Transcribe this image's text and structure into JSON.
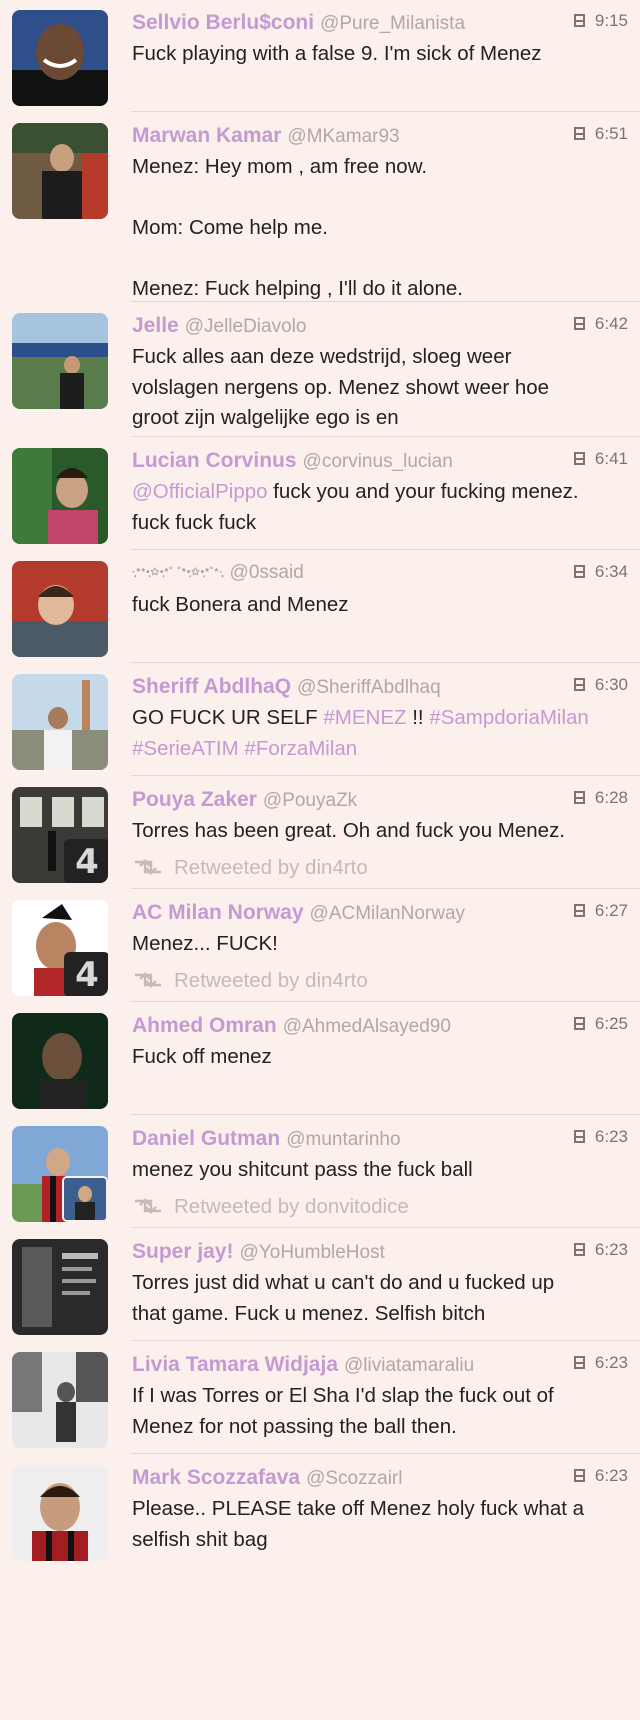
{
  "colors": {
    "background": "#fcf0ec",
    "name": "#c49ad3",
    "handle": "#b1a7a5",
    "text": "#222222",
    "retweet": "#c6b9b6"
  },
  "tweets": [
    {
      "name": "Sellvio Berlu$coni",
      "handle": "@Pure_Milanista",
      "time": "9:15",
      "lines": [
        [
          {
            "t": "Fuck playing with a false 9. I'm sick of Menez"
          }
        ]
      ]
    },
    {
      "name": "Marwan Kamar",
      "handle": "@MKamar93",
      "time": "6:51",
      "lines": [
        [
          {
            "t": "Menez: Hey mom , am free now."
          }
        ],
        [],
        [
          {
            "t": "Mom: Come help me."
          }
        ],
        [],
        [
          {
            "t": "Menez: Fuck helping , I'll do it alone."
          }
        ]
      ]
    },
    {
      "name": "Jelle",
      "handle": "@JelleDiavolo",
      "time": "6:42",
      "lines": [
        [
          {
            "t": "Fuck alles aan deze wedstrijd, sloeg weer"
          }
        ],
        [
          {
            "t": "volslagen nergens op. Menez showt weer hoe"
          }
        ],
        [
          {
            "t": "groot zijn walgelijke ego is en"
          }
        ]
      ]
    },
    {
      "name": "Lucian Corvinus",
      "handle": "@corvinus_lucian",
      "time": "6:41",
      "lines": [
        [
          {
            "t": "@OfficialPippo",
            "k": "mention"
          },
          {
            "t": " fuck you and your fucking menez."
          }
        ],
        [
          {
            "t": "fuck fuck fuck"
          }
        ]
      ]
    },
    {
      "name": "·̩̩̥͙**•̩̩͙✩•̩̩͙*˚ ˚*•̩̩͙✩•̩̩͙*˚*·̩̩̥͙",
      "handle": "@0ssaid",
      "time": "6:34",
      "lines": [
        [
          {
            "t": "fuck Bonera and Menez"
          }
        ]
      ]
    },
    {
      "name": "Sheriff AbdlhaQ",
      "handle": "@SheriffAbdlhaq",
      "time": "6:30",
      "lines": [
        [
          {
            "t": "GO FUCK UR SELF "
          },
          {
            "t": "#MENEZ",
            "k": "hashtag"
          },
          {
            "t": " !! "
          },
          {
            "t": "#SampdoriaMilan",
            "k": "hashtag"
          }
        ],
        [
          {
            "t": "#SerieATIM",
            "k": "hashtag"
          },
          {
            "t": " "
          },
          {
            "t": "#ForzaMilan",
            "k": "hashtag"
          }
        ]
      ]
    },
    {
      "name": "Pouya Zaker",
      "handle": "@PouyaZk",
      "time": "6:28",
      "lines": [
        [
          {
            "t": "Torres has been great. Oh and fuck you Menez."
          }
        ]
      ],
      "retweet": "Retweeted by din4rto",
      "badge": "4"
    },
    {
      "name": "AC Milan Norway",
      "handle": "@ACMilanNorway",
      "time": "6:27",
      "lines": [
        [
          {
            "t": "Menez... FUCK!"
          }
        ]
      ],
      "retweet": "Retweeted by din4rto",
      "badge": "4"
    },
    {
      "name": "Ahmed Omran",
      "handle": "@AhmedAlsayed90",
      "time": "6:25",
      "lines": [
        [
          {
            "t": "Fuck off menez"
          }
        ]
      ]
    },
    {
      "name": "Daniel Gutman",
      "handle": "@muntarinho",
      "time": "6:23",
      "lines": [
        [
          {
            "t": "menez you shitcunt pass the fuck ball"
          }
        ]
      ],
      "retweet": "Retweeted by donvitodice",
      "subavatar": true
    },
    {
      "name": "Super jay!",
      "handle": "@YoHumbleHost",
      "time": "6:23",
      "lines": [
        [
          {
            "t": "Torres just did what u can't do and u fucked up"
          }
        ],
        [
          {
            "t": "that game. Fuck u menez. Selfish bitch"
          }
        ]
      ]
    },
    {
      "name": "Livia Tamara Widjaja",
      "handle": "@liviatamaraliu",
      "time": "6:23",
      "lines": [
        [
          {
            "t": "If I was Torres or El Sha I'd slap the fuck out of"
          }
        ],
        [
          {
            "t": "Menez for not passing the ball then."
          }
        ]
      ]
    },
    {
      "name": "Mark Scozzafava",
      "handle": "@Scozzairl",
      "time": "6:23",
      "lines": [
        [
          {
            "t": "Please.. PLEASE take off Menez holy fuck what a"
          }
        ],
        [
          {
            "t": "selfish shit bag"
          }
        ]
      ]
    }
  ]
}
